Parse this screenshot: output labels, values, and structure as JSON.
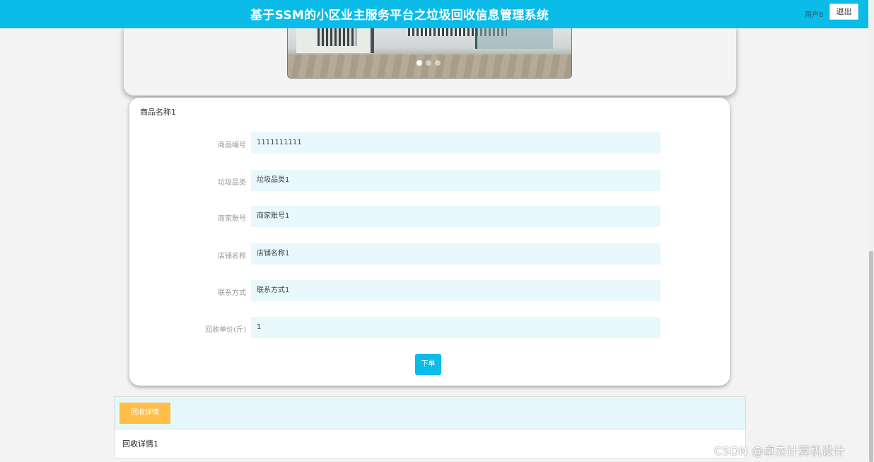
{
  "header": {
    "title": "基于SSM的小区业主服务平台之垃圾回收信息管理系统",
    "user": "用户8",
    "logout_label": "退出"
  },
  "product": {
    "name": "商品名称1",
    "fields": [
      {
        "label": "商品编号",
        "value": "1111111111"
      },
      {
        "label": "垃圾品类",
        "value": "垃圾品类1"
      },
      {
        "label": "商家账号",
        "value": "商家账号1"
      },
      {
        "label": "店铺名称",
        "value": "店铺名称1"
      },
      {
        "label": "联系方式",
        "value": "联系方式1"
      },
      {
        "label": "回收单价(斤)",
        "value": "1"
      }
    ],
    "order_label": "下单"
  },
  "details": {
    "tab_label": "回收详情",
    "content": "回收详情1"
  },
  "watermark": "CSDN @卓杰计算机设计",
  "colors": {
    "primary": "#0bbbe8",
    "tab_accent": "#ffbe47",
    "field_bg": "#e8f8fd"
  }
}
